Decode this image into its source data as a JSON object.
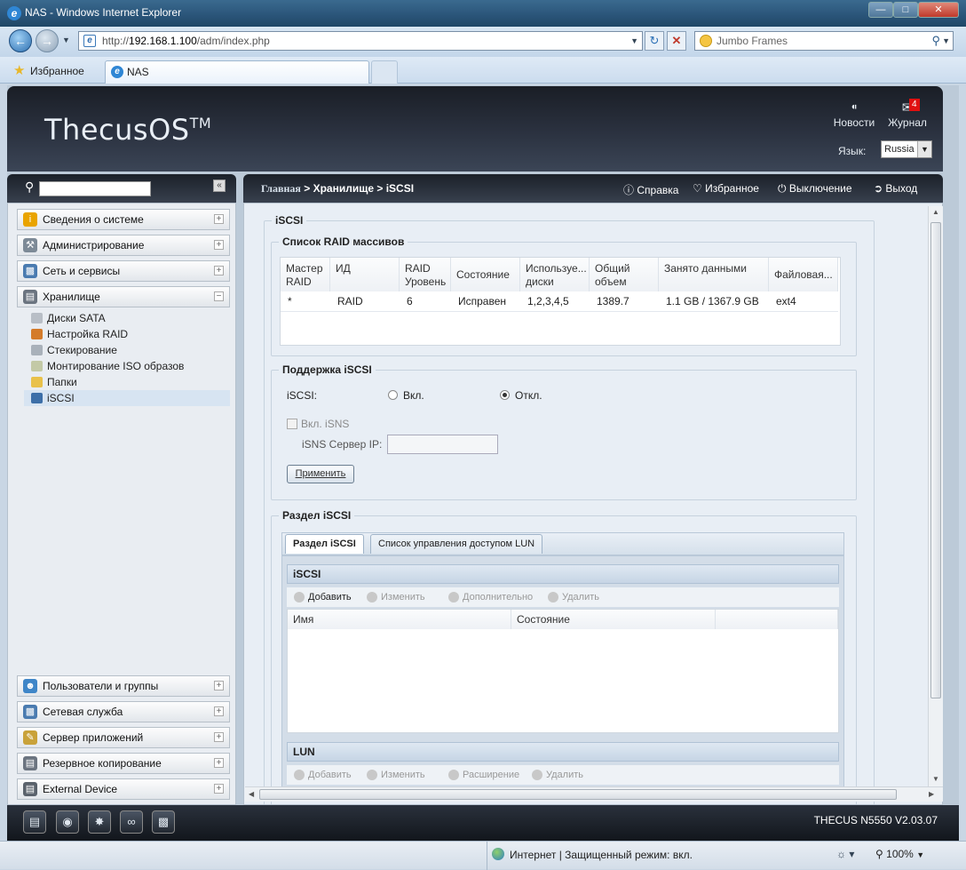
{
  "browser": {
    "title": "NAS - Windows Internet Explorer",
    "url_prefix": "http://",
    "url_host": "192.168.1.100",
    "url_path": "/adm/index.php",
    "search_text": "Jumbo Frames",
    "favorites_label": "Избранное",
    "tab_label": "NAS",
    "status_zone": "Интернет | Защищенный режим: вкл.",
    "zoom": "100%"
  },
  "header": {
    "logo": "ThecusOS",
    "logo_tm": "TM",
    "news_label": "Новости",
    "log_label": "Журнал",
    "log_badge": "4",
    "lang_label": "Язык:",
    "lang_value": "Russia"
  },
  "sidebar": {
    "categories_top": [
      {
        "label": "Сведения о системе"
      },
      {
        "label": "Администрирование"
      },
      {
        "label": "Сеть и сервисы"
      },
      {
        "label": "Хранилище"
      }
    ],
    "storage_items": [
      {
        "label": "Диски SATA"
      },
      {
        "label": "Настройка RAID"
      },
      {
        "label": "Стекирование"
      },
      {
        "label": "Монтирование ISO образов"
      },
      {
        "label": "Папки"
      },
      {
        "label": "iSCSI"
      }
    ],
    "categories_bottom": [
      {
        "label": "Пользователи и группы"
      },
      {
        "label": "Сетевая служба"
      },
      {
        "label": "Сервер приложений"
      },
      {
        "label": "Резервное копирование"
      },
      {
        "label": "External Device"
      }
    ]
  },
  "breadcrumb": {
    "home": "Главная",
    "path": " > Хранилище > iSCSI",
    "help": "Справка",
    "favorites": "Избранное",
    "shutdown": "Выключение",
    "logout": "Выход"
  },
  "main": {
    "section_title": "iSCSI",
    "raid_list": {
      "legend": "Список RAID массивов",
      "headers": [
        "Мастер RAID",
        "ИД",
        "RAID Уровень",
        "Состояние",
        "Используе... диски",
        "Общий объем",
        "Занято данными",
        "Файловая..."
      ],
      "row": [
        "*",
        "RAID",
        "6",
        "Исправен",
        "1,2,3,4,5",
        "1389.7",
        "1.1 GB / 1367.9 GB",
        "ext4"
      ]
    },
    "support": {
      "legend": "Поддержка iSCSI",
      "iscsi_label": "iSCSI:",
      "on_label": "Вкл.",
      "off_label": "Откл.",
      "isns_label": "Вкл. iSNS",
      "isns_server_label": "iSNS Сервер IP:",
      "isns_server_value": "",
      "apply_label": "Применить"
    },
    "partition": {
      "legend": "Раздел iSCSI",
      "tab1": "Раздел iSCSI",
      "tab2": "Список управления доступом LUN",
      "iscsi_title": "iSCSI",
      "add": "Добавить",
      "edit": "Изменить",
      "advanced": "Дополнительно",
      "delete": "Удалить",
      "col_name": "Имя",
      "col_state": "Состояние",
      "lun_title": "LUN",
      "lun_add": "Добавить",
      "lun_edit": "Изменить",
      "lun_expand": "Расширение",
      "lun_delete": "Удалить"
    }
  },
  "footer": {
    "version": "THECUS N5550  V2.03.07"
  }
}
